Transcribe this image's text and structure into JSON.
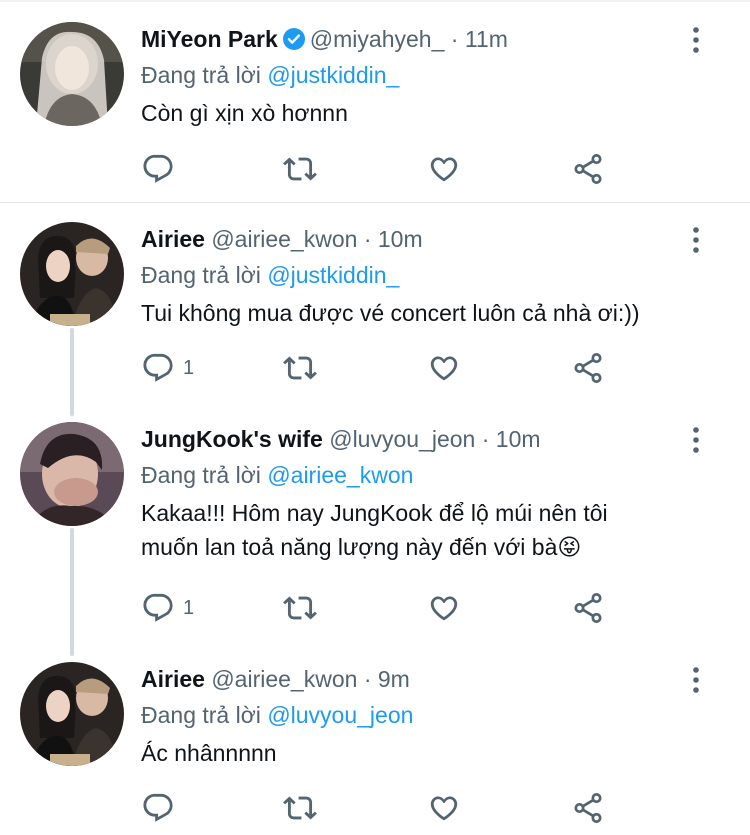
{
  "colors": {
    "accent": "#1d9bf0",
    "muted": "#536471",
    "text": "#0f1419"
  },
  "tweets": [
    {
      "name": "MiYeon Park",
      "verified": true,
      "handle": "@miyahyeh_",
      "dot": "·",
      "time": "11m",
      "reply_prefix": "Đang trả lời",
      "reply_to": "@justkiddin_",
      "text": "Còn gì xịn xò hơnnn",
      "reply_count": ""
    },
    {
      "name": "Airiee",
      "verified": false,
      "handle": "@airiee_kwon",
      "dot": "·",
      "time": "10m",
      "reply_prefix": "Đang trả lời",
      "reply_to": "@justkiddin_",
      "text": "Tui không mua được vé concert luôn cả nhà ơi:))",
      "reply_count": "1"
    },
    {
      "name": "JungKook's wife",
      "verified": false,
      "handle": "@luvyou_jeon",
      "dot": "·",
      "time": "10m",
      "reply_prefix": "Đang trả lời",
      "reply_to": "@airiee_kwon",
      "text_line1": "Kakaa!!! Hôm nay JungKook để lộ múi nên tôi",
      "text_line2": "muốn lan toả năng lượng này đến với bà😝",
      "reply_count": "1"
    },
    {
      "name": "Airiee",
      "verified": false,
      "handle": "@airiee_kwon",
      "dot": "·",
      "time": "9m",
      "reply_prefix": "Đang trả lời",
      "reply_to": "@luvyou_jeon",
      "text": "Ác nhânnnnn",
      "reply_count": ""
    }
  ],
  "icons": [
    "reply-icon",
    "retweet-icon",
    "like-icon",
    "share-icon",
    "more-options-icon",
    "verified-badge-icon"
  ]
}
